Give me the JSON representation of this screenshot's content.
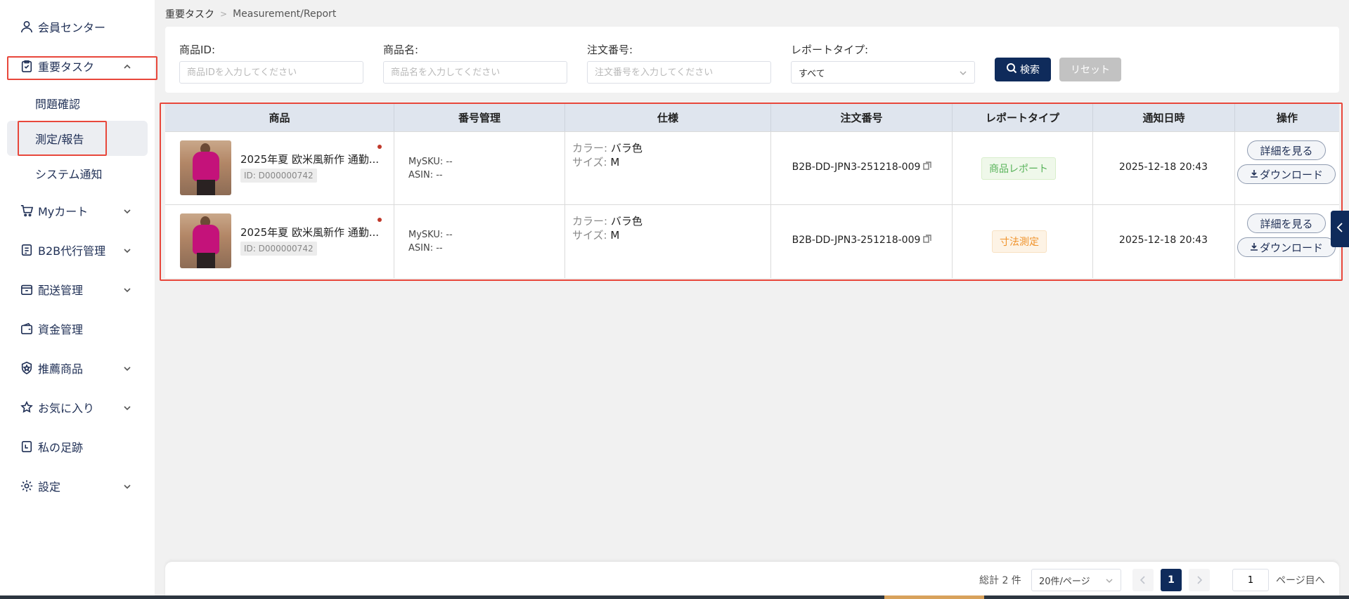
{
  "sidebar": {
    "member_center": "会員センター",
    "important_tasks": "重要タスク",
    "sub_issue_confirm": "問題確認",
    "sub_measurement": "測定/報告",
    "sub_system_notice": "システム通知",
    "my_cart": "Myカート",
    "b2b_agent": "B2B代行管理",
    "delivery": "配送管理",
    "funds": "資金管理",
    "recommended": "推薦商品",
    "favorites": "お気に入り",
    "footprints": "私の足跡",
    "settings": "設定"
  },
  "breadcrumb": {
    "root": "重要タスク",
    "current": "Measurement/Report"
  },
  "filter": {
    "product_id_label": "商品ID:",
    "product_id_placeholder": "商品IDを入力してください",
    "product_name_label": "商品名:",
    "product_name_placeholder": "商品名を入力してください",
    "order_no_label": "注文番号:",
    "order_no_placeholder": "注文番号を入力してください",
    "report_type_label": "レポートタイプ:",
    "report_type_value": "すべて",
    "search_label": "検索",
    "reset_label": "リセット"
  },
  "table": {
    "headers": [
      "商品",
      "番号管理",
      "仕様",
      "注文番号",
      "レポートタイプ",
      "通知日時",
      "操作"
    ],
    "rows": [
      {
        "product_name": "2025年夏 欧米風新作 通勤...",
        "product_id": "ID: D000000742",
        "mysku": "MySKU: --",
        "asin": "ASIN: --",
        "color_key": "カラー:",
        "color_val": "バラ色",
        "size_key": "サイズ:",
        "size_val": "M",
        "order_no": "B2B-DD-JPN3-251218-009",
        "report_type": "商品レポート",
        "date": "2025-12-18 20:43",
        "detail_label": "詳細を見る",
        "download_label": "ダウンロード"
      },
      {
        "product_name": "2025年夏 欧米風新作 通勤...",
        "product_id": "ID: D000000742",
        "mysku": "MySKU: --",
        "asin": "ASIN: --",
        "color_key": "カラー:",
        "color_val": "バラ色",
        "size_key": "サイズ:",
        "size_val": "M",
        "order_no": "B2B-DD-JPN3-251218-009",
        "report_type": "寸法測定",
        "date": "2025-12-18 20:43",
        "detail_label": "詳細を見る",
        "download_label": "ダウンロード"
      }
    ]
  },
  "pagination": {
    "total": "総計 2 件",
    "page_size": "20件/ページ",
    "current_page": "1",
    "jump_value": "1",
    "jump_label": "ページ目へ"
  },
  "colors": {
    "brand": "#0f2b5b",
    "highlight": "#e8473b",
    "tag_green": "#58b35a",
    "tag_orange": "#f0932b"
  }
}
